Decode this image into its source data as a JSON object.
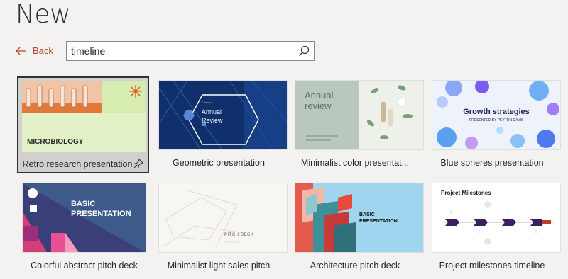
{
  "header": {
    "title": "New"
  },
  "nav": {
    "back_label": "Back"
  },
  "search": {
    "value": "timeline"
  },
  "templates": [
    {
      "label": "Retro research presentation",
      "thumb_text": "MICROBIOLOGY"
    },
    {
      "label": "Geometric presentation",
      "thumb_text": "Annual Review",
      "thumb_small": "Contoso"
    },
    {
      "label": "Minimalist color presentat...",
      "thumb_text": "Annual review"
    },
    {
      "label": "Blue spheres presentation",
      "thumb_text": "Growth strategies",
      "thumb_sub": "PRESENTED BY PEYTON DAVIS"
    },
    {
      "label": "Colorful abstract pitch deck",
      "thumb_text": "BASIC PRESENTATION"
    },
    {
      "label": "Minimalist light sales pitch",
      "thumb_text": "PITCH DECK"
    },
    {
      "label": "Architecture pitch deck",
      "thumb_text": "BASIC PRESENTATION"
    },
    {
      "label": "Project milestones timeline",
      "thumb_text": "Project Milestones"
    }
  ],
  "colors": {
    "accent": "#b7472a",
    "background": "#f3f2f1"
  }
}
